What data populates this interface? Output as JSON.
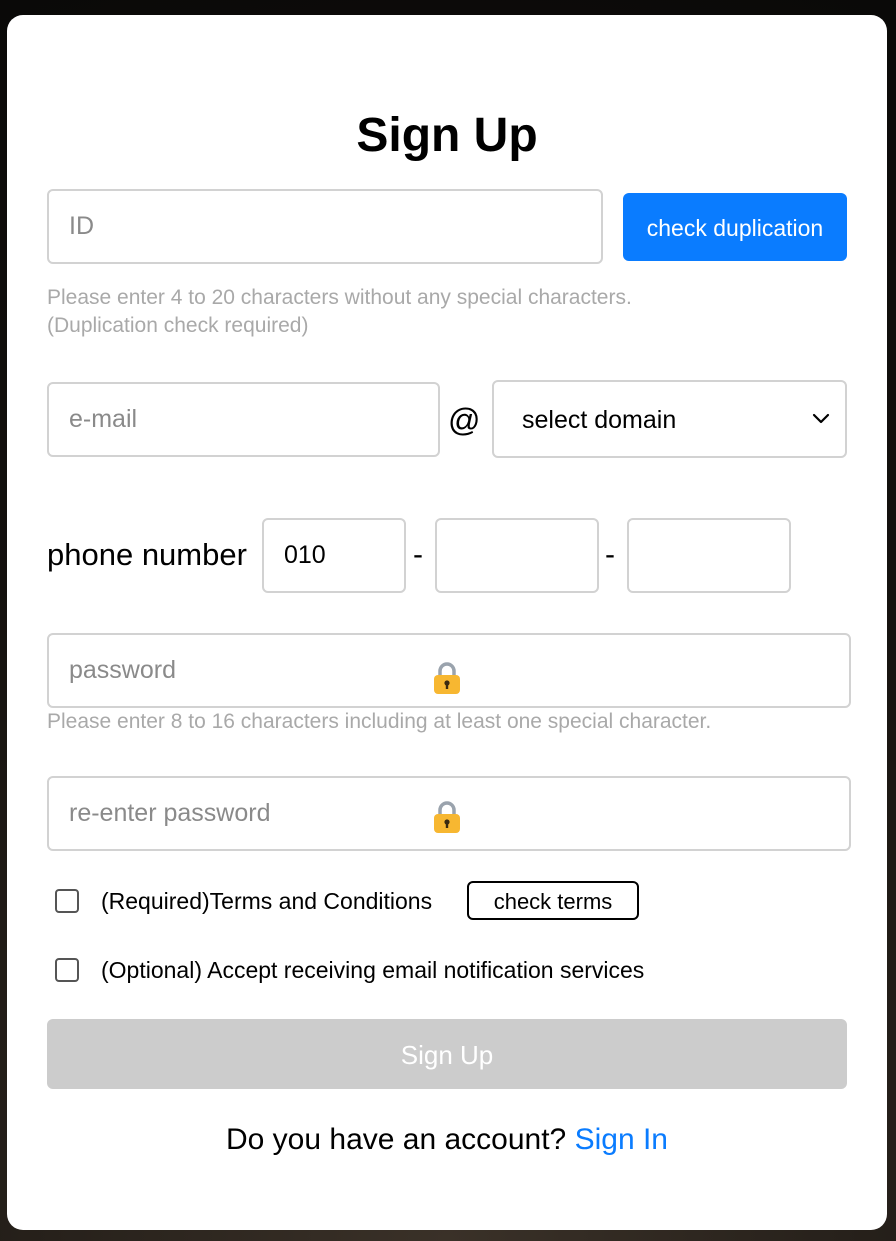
{
  "page": {
    "title": "Sign Up"
  },
  "id_field": {
    "placeholder": "ID",
    "check_button": "check duplication",
    "hint_line1": "Please enter 4 to 20 characters without any special characters.",
    "hint_line2": "(Duplication check required)"
  },
  "email": {
    "placeholder": "e-mail",
    "at_symbol": "@",
    "domain_select": "select domain"
  },
  "phone": {
    "label": "phone number",
    "part1": "010",
    "part2": "",
    "part3": "",
    "separator": "-"
  },
  "password": {
    "placeholder": "password",
    "hint": "Please enter 8 to 16 characters including at least one special character.",
    "lock_icon": "lock-icon"
  },
  "password_confirm": {
    "placeholder": "re-enter password",
    "lock_icon": "lock-icon"
  },
  "terms": {
    "required_label": "(Required)Terms and Conditions",
    "check_terms_button": "check terms",
    "optional_label": "(Optional) Accept receiving email notification services"
  },
  "submit": {
    "label": "Sign Up"
  },
  "footer": {
    "question": "Do you have an account?",
    "signin_link": "Sign In"
  },
  "colors": {
    "accent": "#0a7cff",
    "disabled_button": "#cccccc",
    "hint_text": "#a9a9a9",
    "border": "#d2d2d2"
  }
}
